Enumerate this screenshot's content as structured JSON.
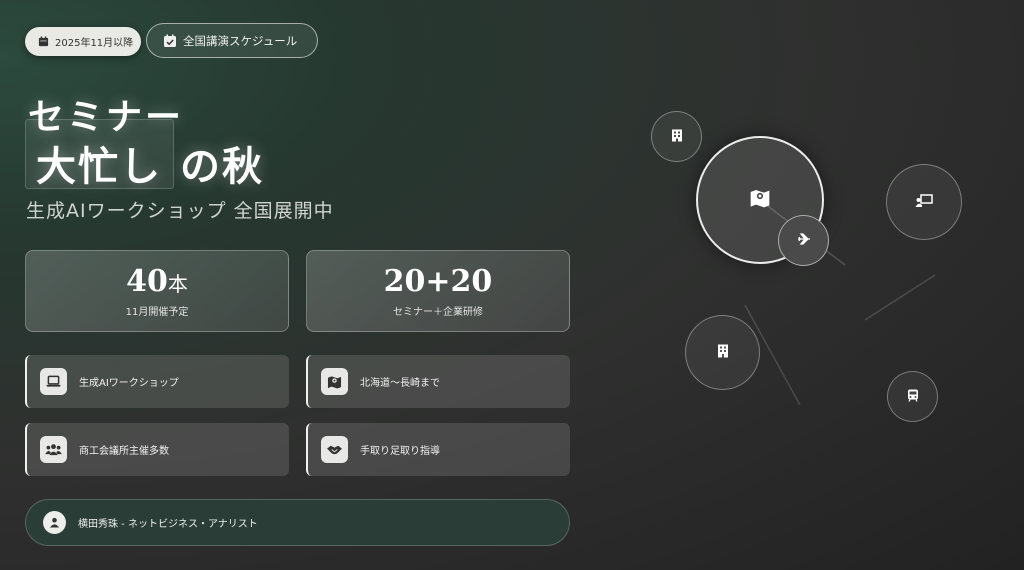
{
  "header": {
    "date_pill": "2025年11月以降",
    "schedule_button": "全国講演スケジュール"
  },
  "hero": {
    "title_line1": "セミナー",
    "title_highlight": "大忙し",
    "title_rest": "の秋",
    "subtitle": "生成AIワークショップ 全国展開中"
  },
  "stats": [
    {
      "value": "40",
      "unit": "本",
      "label": "11月開催予定"
    },
    {
      "value": "20+20",
      "unit": "",
      "label": "セミナー＋企業研修"
    }
  ],
  "features": [
    {
      "label": "生成AIワークショップ",
      "icon": "laptop-icon"
    },
    {
      "label": "北海道〜長崎まで",
      "icon": "map-icon"
    },
    {
      "label": "商工会議所主催多数",
      "icon": "users-icon"
    },
    {
      "label": "手取り足取り指導",
      "icon": "handshake-icon"
    }
  ],
  "author": {
    "name": "横田秀珠 - ネットビジネス・アナリスト"
  },
  "network": {
    "icons": [
      "building-icon",
      "map-icon",
      "airplane-icon",
      "presentation-icon",
      "office-building-icon",
      "train-icon"
    ]
  },
  "colors": {
    "accent_green": "#2a3e37",
    "panel": "#e8e8e6"
  }
}
